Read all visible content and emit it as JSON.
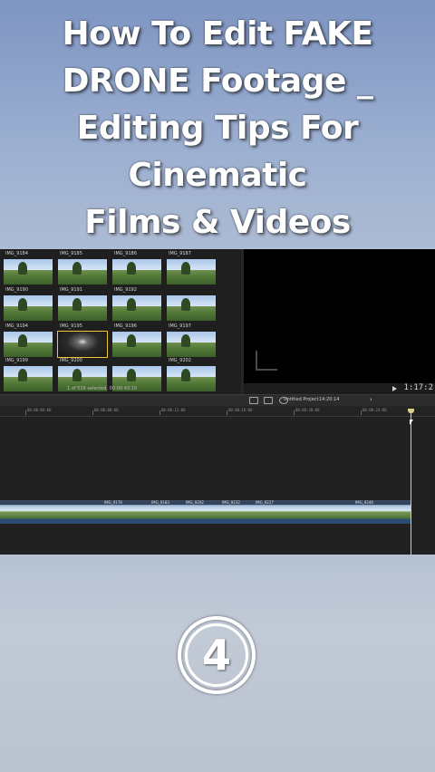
{
  "title": {
    "lines": [
      "How To Edit FAKE",
      "DRONE Footage _",
      "Editing Tips For",
      "Cinematic",
      "Films & Videos"
    ]
  },
  "browser": {
    "clips": [
      {
        "label": "IMG_9184"
      },
      {
        "label": "IMG_9185"
      },
      {
        "label": "IMG_9186"
      },
      {
        "label": "IMG_9187"
      },
      {
        "label": "IMG_9190"
      },
      {
        "label": "IMG_9191"
      },
      {
        "label": "IMG_9192"
      },
      {
        "label": ""
      },
      {
        "label": "IMG_9194"
      },
      {
        "label": "IMG_9195"
      },
      {
        "label": "IMG_9196"
      },
      {
        "label": "IMG_9197"
      },
      {
        "label": "IMG_9199"
      },
      {
        "label": "IMG_9200"
      },
      {
        "label": ""
      },
      {
        "label": "IMG_9202"
      }
    ],
    "status": "1 of 516 selected, 00:00:43:10"
  },
  "viewer": {
    "timecode": "1:17:2"
  },
  "toolbar": {
    "project_name": "Untitled Project",
    "project_length": "14:20:14"
  },
  "ruler": {
    "labels": [
      "00:00:04:00",
      "00:00:08:00",
      "00:00:12:00",
      "00:00:16:00",
      "00:00:20:00",
      "00:00:24:00"
    ]
  },
  "timeline": {
    "segments": [
      {
        "label": ""
      },
      {
        "label": ""
      },
      {
        "label": "IMG_9176"
      },
      {
        "label": "IMG_9183"
      },
      {
        "label": "IMG_9202"
      },
      {
        "label": "IMG_9232"
      },
      {
        "label": "IMG_9227"
      },
      {
        "label": ""
      },
      {
        "label": "IMG_9246"
      }
    ]
  },
  "step": {
    "number": "4"
  },
  "colors": {
    "title_text": "#ffffff",
    "editor_bg": "#262626",
    "playhead": "#d9d08a"
  }
}
